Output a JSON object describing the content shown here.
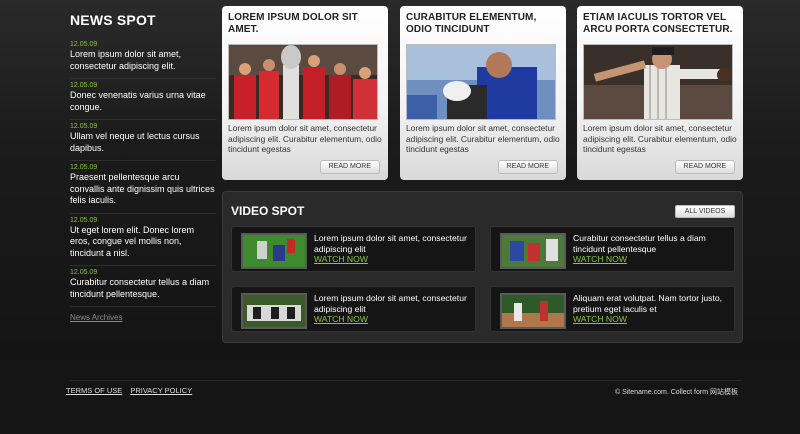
{
  "news": {
    "title": "NEWS SPOT",
    "items": [
      {
        "date": "12.05.09",
        "text": "Lorem ipsum dolor sit amet, consectetur adipiscing elit."
      },
      {
        "date": "12.05.09",
        "text": "Donec venenatis varius urna vitae congue."
      },
      {
        "date": "12.05.09",
        "text": "Ullam vel neque ut lectus cursus dapibus."
      },
      {
        "date": "12.05.09",
        "text": "Praesent pellentesque arcu convallis ante dignissim quis ultrices felis iaculis."
      },
      {
        "date": "12.05.09",
        "text": "Ut eget lorem elit. Donec lorem eros, congue vel mollis non, tincidunt a nisl."
      },
      {
        "date": "12.05.09",
        "text": "Curabitur consectetur tellus a diam tincidunt pellentesque."
      }
    ],
    "archive_label": "News Archives"
  },
  "cards": [
    {
      "title": "LOREM IPSUM DOLOR SIT AMET.",
      "body": "Lorem ipsum dolor sit amet, consectetur adipiscing elit. Curabitur elementum, odio tincidunt egestas",
      "button": "READ MORE"
    },
    {
      "title": "CURABITUR ELEMENTUM, ODIO TINCIDUNT",
      "body": "Lorem ipsum dolor sit amet, consectetur adipiscing elit. Curabitur elementum, odio tincidunt egestas",
      "button": "READ MORE"
    },
    {
      "title": "ETIAM IACULIS TORTOR VEL ARCU PORTA CONSECTETUR.",
      "body": "Lorem ipsum dolor sit amet, consectetur adipiscing elit. Curabitur elementum, odio tincidunt egestas",
      "button": "READ MORE"
    }
  ],
  "video": {
    "title": "VIDEO SPOT",
    "all_label": "ALL VIDEOS",
    "items": [
      {
        "text": "Lorem ipsum dolor sit amet, consectetur adipiscing elit",
        "link": "WATCH NOW"
      },
      {
        "text": "Curabitur consectetur tellus a diam tincidunt pellentesque",
        "link": "WATCH NOW"
      },
      {
        "text": "Lorem ipsum dolor sit amet, consectetur adipiscing elit",
        "link": "WATCH NOW"
      },
      {
        "text": "Aliquam erat volutpat. Nam tortor justo, pretium eget iaculis et",
        "link": "WATCH NOW"
      }
    ]
  },
  "footer": {
    "terms": "TERMS OF USE",
    "privacy": "PRIVACY POLICY",
    "copyright": "© Sitename.com. Collect form 网站模板"
  },
  "colors": {
    "accent": "#8cc43a",
    "background": "#151515"
  }
}
